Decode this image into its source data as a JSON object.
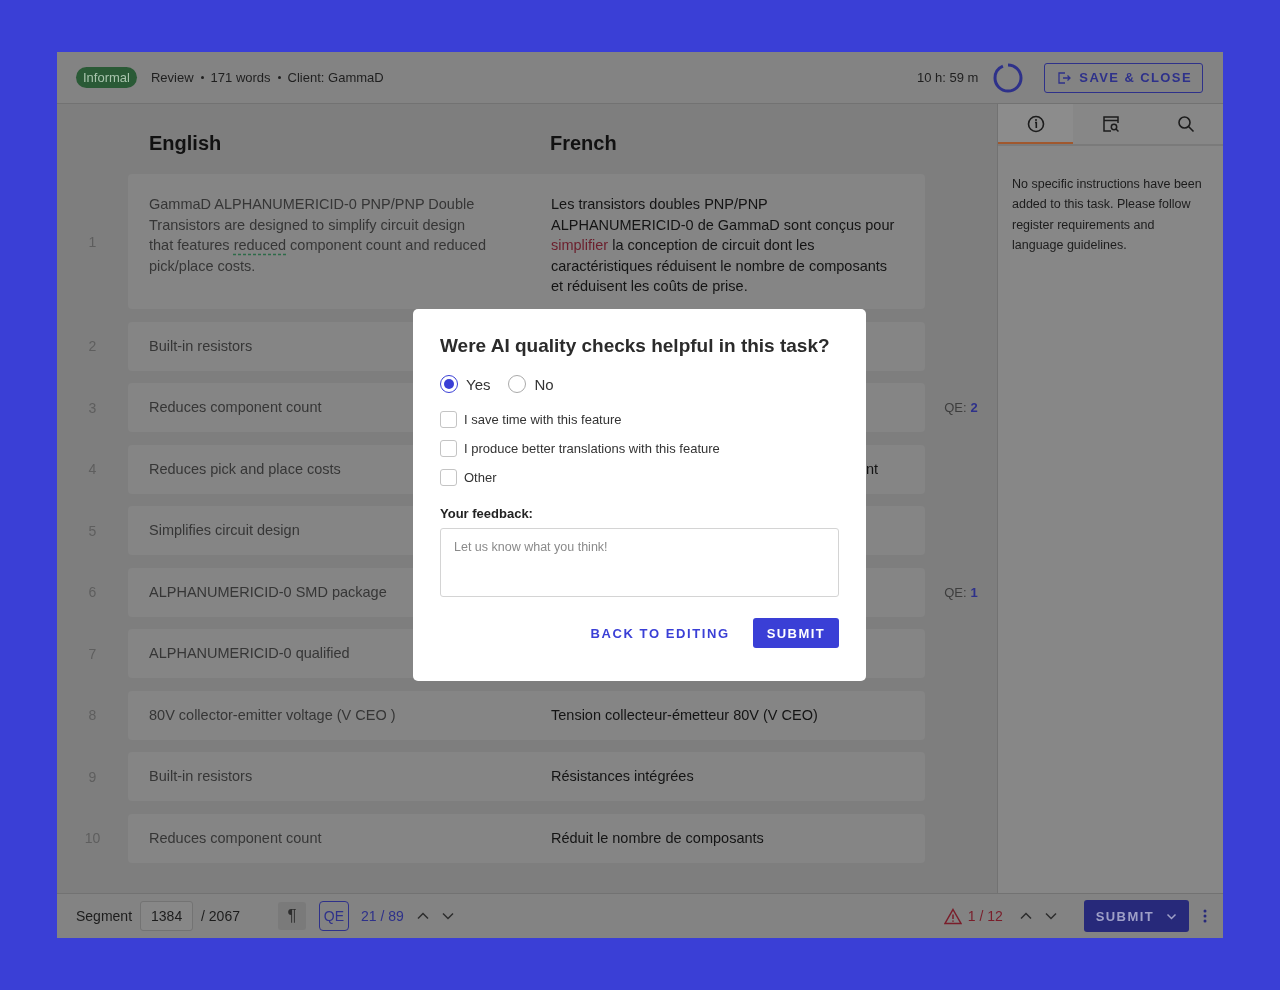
{
  "header": {
    "badge": "Informal",
    "meta": [
      "Review",
      "171 words",
      "Client: GammaD"
    ],
    "timer": {
      "text": "10 h: 59 m",
      "level": 0.93
    },
    "save_button": "SAVE & CLOSE"
  },
  "columns": {
    "source": "English",
    "target": "French"
  },
  "rows": [
    {
      "number": "1",
      "source": [
        {
          "kind": "plain",
          "text": "GammaD ALPHANUMERICID-0 PNP/PNP Double Transistors are designed to simplify circuit design that features "
        },
        {
          "kind": "flagged",
          "text": "reduced"
        },
        {
          "kind": "plain",
          "text": " component count and reduced pick/place costs."
        }
      ],
      "target": [
        {
          "kind": "plain",
          "text": "Les transistors doubles PNP/PNP ALPHANUMERICID-0 de GammaD sont conçus pour "
        },
        {
          "kind": "error",
          "text": "simplifier"
        },
        {
          "kind": "plain",
          "text": " la conception de circuit dont les caractéristiques réduisent le nombre de composants et réduisent les coûts de prise."
        }
      ]
    },
    {
      "number": "2",
      "source": [
        {
          "kind": "plain",
          "text": "Built-in resistors"
        }
      ]
    },
    {
      "number": "3",
      "source": [
        {
          "kind": "plain",
          "text": "Reduces component count"
        }
      ],
      "qe": {
        "label": "QE:",
        "value": "2"
      }
    },
    {
      "number": "4",
      "source": [
        {
          "kind": "plain",
          "text": "Reduces pick and place costs"
        }
      ],
      "target": [
        {
          "kind": "plain",
          "text": "nt"
        }
      ],
      "target_covered": true
    },
    {
      "number": "5",
      "source": [
        {
          "kind": "plain",
          "text": "Simplifies circuit design"
        }
      ]
    },
    {
      "number": "6",
      "source": [
        {
          "kind": "plain",
          "text": "ALPHANUMERICID-0 SMD package"
        }
      ],
      "qe": {
        "label": "QE:",
        "value": "1"
      }
    },
    {
      "number": "7",
      "source": [
        {
          "kind": "plain",
          "text": "ALPHANUMERICID-0 qualified"
        }
      ]
    },
    {
      "number": "8",
      "source": [
        {
          "kind": "plain",
          "text": "80V collector-emitter voltage (V CEO )"
        }
      ],
      "target": [
        {
          "kind": "plain",
          "text": "Tension collecteur-émetteur 80V (V CEO)"
        }
      ]
    },
    {
      "number": "9",
      "source": [
        {
          "kind": "plain",
          "text": "Built-in resistors"
        }
      ],
      "target": [
        {
          "kind": "plain",
          "text": "Résistances intégrées"
        }
      ]
    },
    {
      "number": "10",
      "source": [
        {
          "kind": "plain",
          "text": "Reduces component count"
        }
      ],
      "target": [
        {
          "kind": "plain",
          "text": "Réduit le nombre de composants"
        }
      ]
    }
  ],
  "side_panel": {
    "tabs": [
      {
        "kind": "info",
        "selected": true
      },
      {
        "kind": "preview",
        "selected": false
      },
      {
        "kind": "search",
        "selected": false
      }
    ],
    "text": "No specific instructions have been added to this task. Please follow register requirements and language guidelines."
  },
  "footer": {
    "segment_label": "Segment",
    "segment_value": "1384",
    "segment_total": "/ 2067",
    "pilcrow": "¶",
    "qe_button": "QE",
    "qe_count": "21 / 89",
    "warnings": "1 / 12",
    "submit": "SUBMIT"
  },
  "dialog": {
    "title": "Were AI quality checks helpful in this task?",
    "options": [
      {
        "label": "Yes",
        "selected": true
      },
      {
        "label": "No",
        "selected": false
      }
    ],
    "checks": [
      {
        "label": "I save time with this feature",
        "checked": false
      },
      {
        "label": "I produce better translations with this feature",
        "checked": false
      },
      {
        "label": "Other",
        "checked": false
      }
    ],
    "feedback_label": "Your feedback:",
    "feedback_placeholder": "Let us know what you think!",
    "back_button": "BACK TO EDITING",
    "submit_button": "SUBMIT"
  }
}
